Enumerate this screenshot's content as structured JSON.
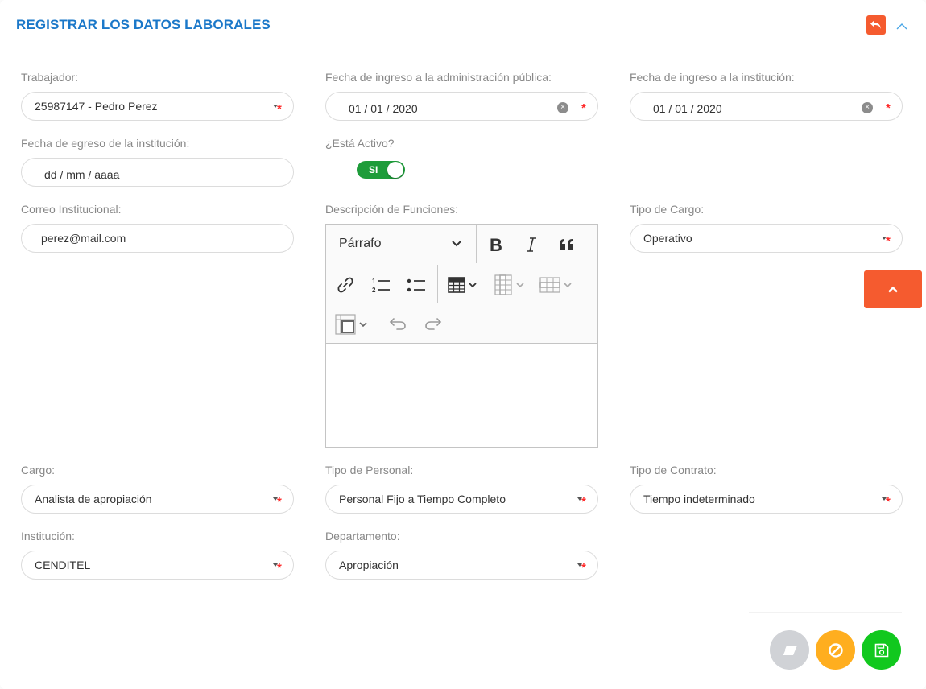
{
  "header": {
    "title": "REGISTRAR LOS DATOS LABORALES",
    "back_icon": "undo-arrow-icon",
    "collapse_icon": "chevron-up-icon"
  },
  "fields": {
    "trabajador": {
      "label": "Trabajador:",
      "value": "25987147 - Pedro Perez"
    },
    "fecha_ingreso_admin": {
      "label": "Fecha de ingreso a la administración pública:",
      "value": "01 / 01 / 2020"
    },
    "fecha_ingreso_inst": {
      "label": "Fecha de ingreso a la institución:",
      "value": "01 / 01 / 2020"
    },
    "fecha_egreso": {
      "label": "Fecha de egreso de la institución:",
      "placeholder": "dd / mm / aaaa"
    },
    "activo": {
      "label": "¿Está Activo?",
      "value": "SI"
    },
    "correo": {
      "label": "Correo Institucional:",
      "value": "perez@mail.com"
    },
    "descripcion": {
      "label": "Descripción de Funciones:",
      "format_value": "Párrafo",
      "content": ""
    },
    "tipo_cargo": {
      "label": "Tipo de Cargo:",
      "value": "Operativo"
    },
    "cargo": {
      "label": "Cargo:",
      "value": "Analista de apropiación"
    },
    "tipo_personal": {
      "label": "Tipo de Personal:",
      "value": "Personal Fijo a Tiempo Completo"
    },
    "tipo_contrato": {
      "label": "Tipo de Contrato:",
      "value": "Tiempo indeterminado"
    },
    "institucion": {
      "label": "Institución:",
      "value": "CENDITEL"
    },
    "departamento": {
      "label": "Departamento:",
      "value": "Apropiación"
    }
  },
  "required_mark": "*",
  "clear_mark": "×",
  "actions": {
    "clear_icon": "eraser-icon",
    "cancel_icon": "ban-icon",
    "save_icon": "floppy-disk-icon",
    "scroll_top_icon": "chevron-up-icon"
  },
  "colors": {
    "title": "#1b78c9",
    "accent_orange": "#f55b2f",
    "toggle_green": "#1e9c3a",
    "clear_gray": "#d0d2d6",
    "cancel_yellow": "#ffae1f",
    "save_green": "#11c81e",
    "required_red": "#ff2a2a"
  }
}
